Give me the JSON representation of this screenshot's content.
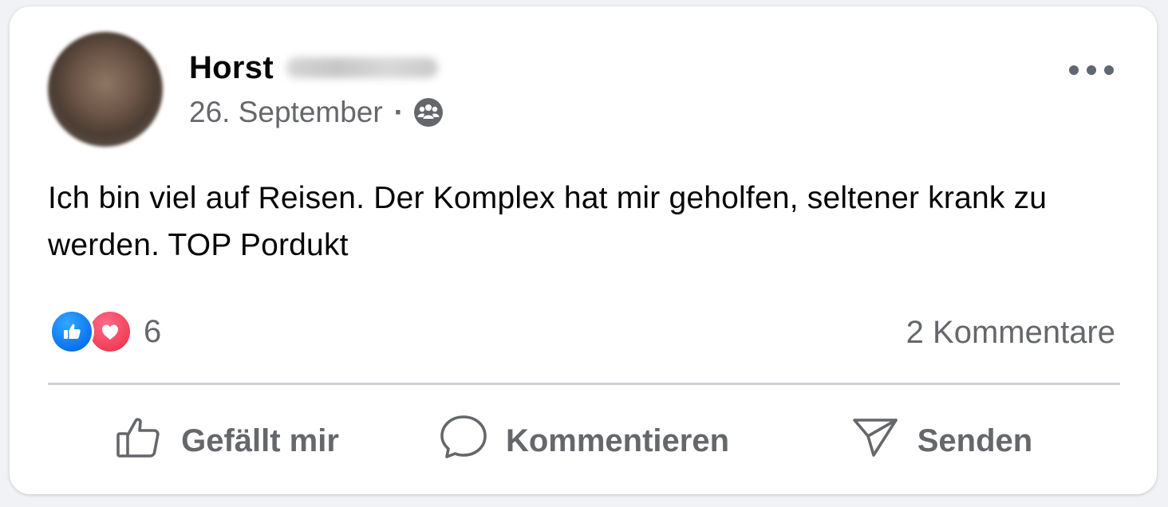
{
  "post": {
    "author": {
      "name": "Horst",
      "avatar": "avatar"
    },
    "date": "26. September",
    "separator": "·",
    "audience_icon": "friends-icon",
    "more_icon": "more-horizontal-icon",
    "text": "Ich bin viel auf Reisen. Der Komplex hat mir geholfen, seltener krank zu werden. TOP Pordukt",
    "reactions": {
      "types": [
        "like-icon",
        "love-icon"
      ],
      "count": "6"
    },
    "comments_count": "2 Kommentare",
    "actions": [
      {
        "label": "Gefällt mir",
        "icon": "thumbs-up-icon"
      },
      {
        "label": "Kommentieren",
        "icon": "comment-icon"
      },
      {
        "label": "Senden",
        "icon": "send-icon"
      }
    ]
  },
  "colors": {
    "text_primary": "#050505",
    "text_secondary": "#65676b",
    "like_blue": "#0a73f0",
    "love_red": "#f33e58",
    "divider": "#ced0d4"
  }
}
